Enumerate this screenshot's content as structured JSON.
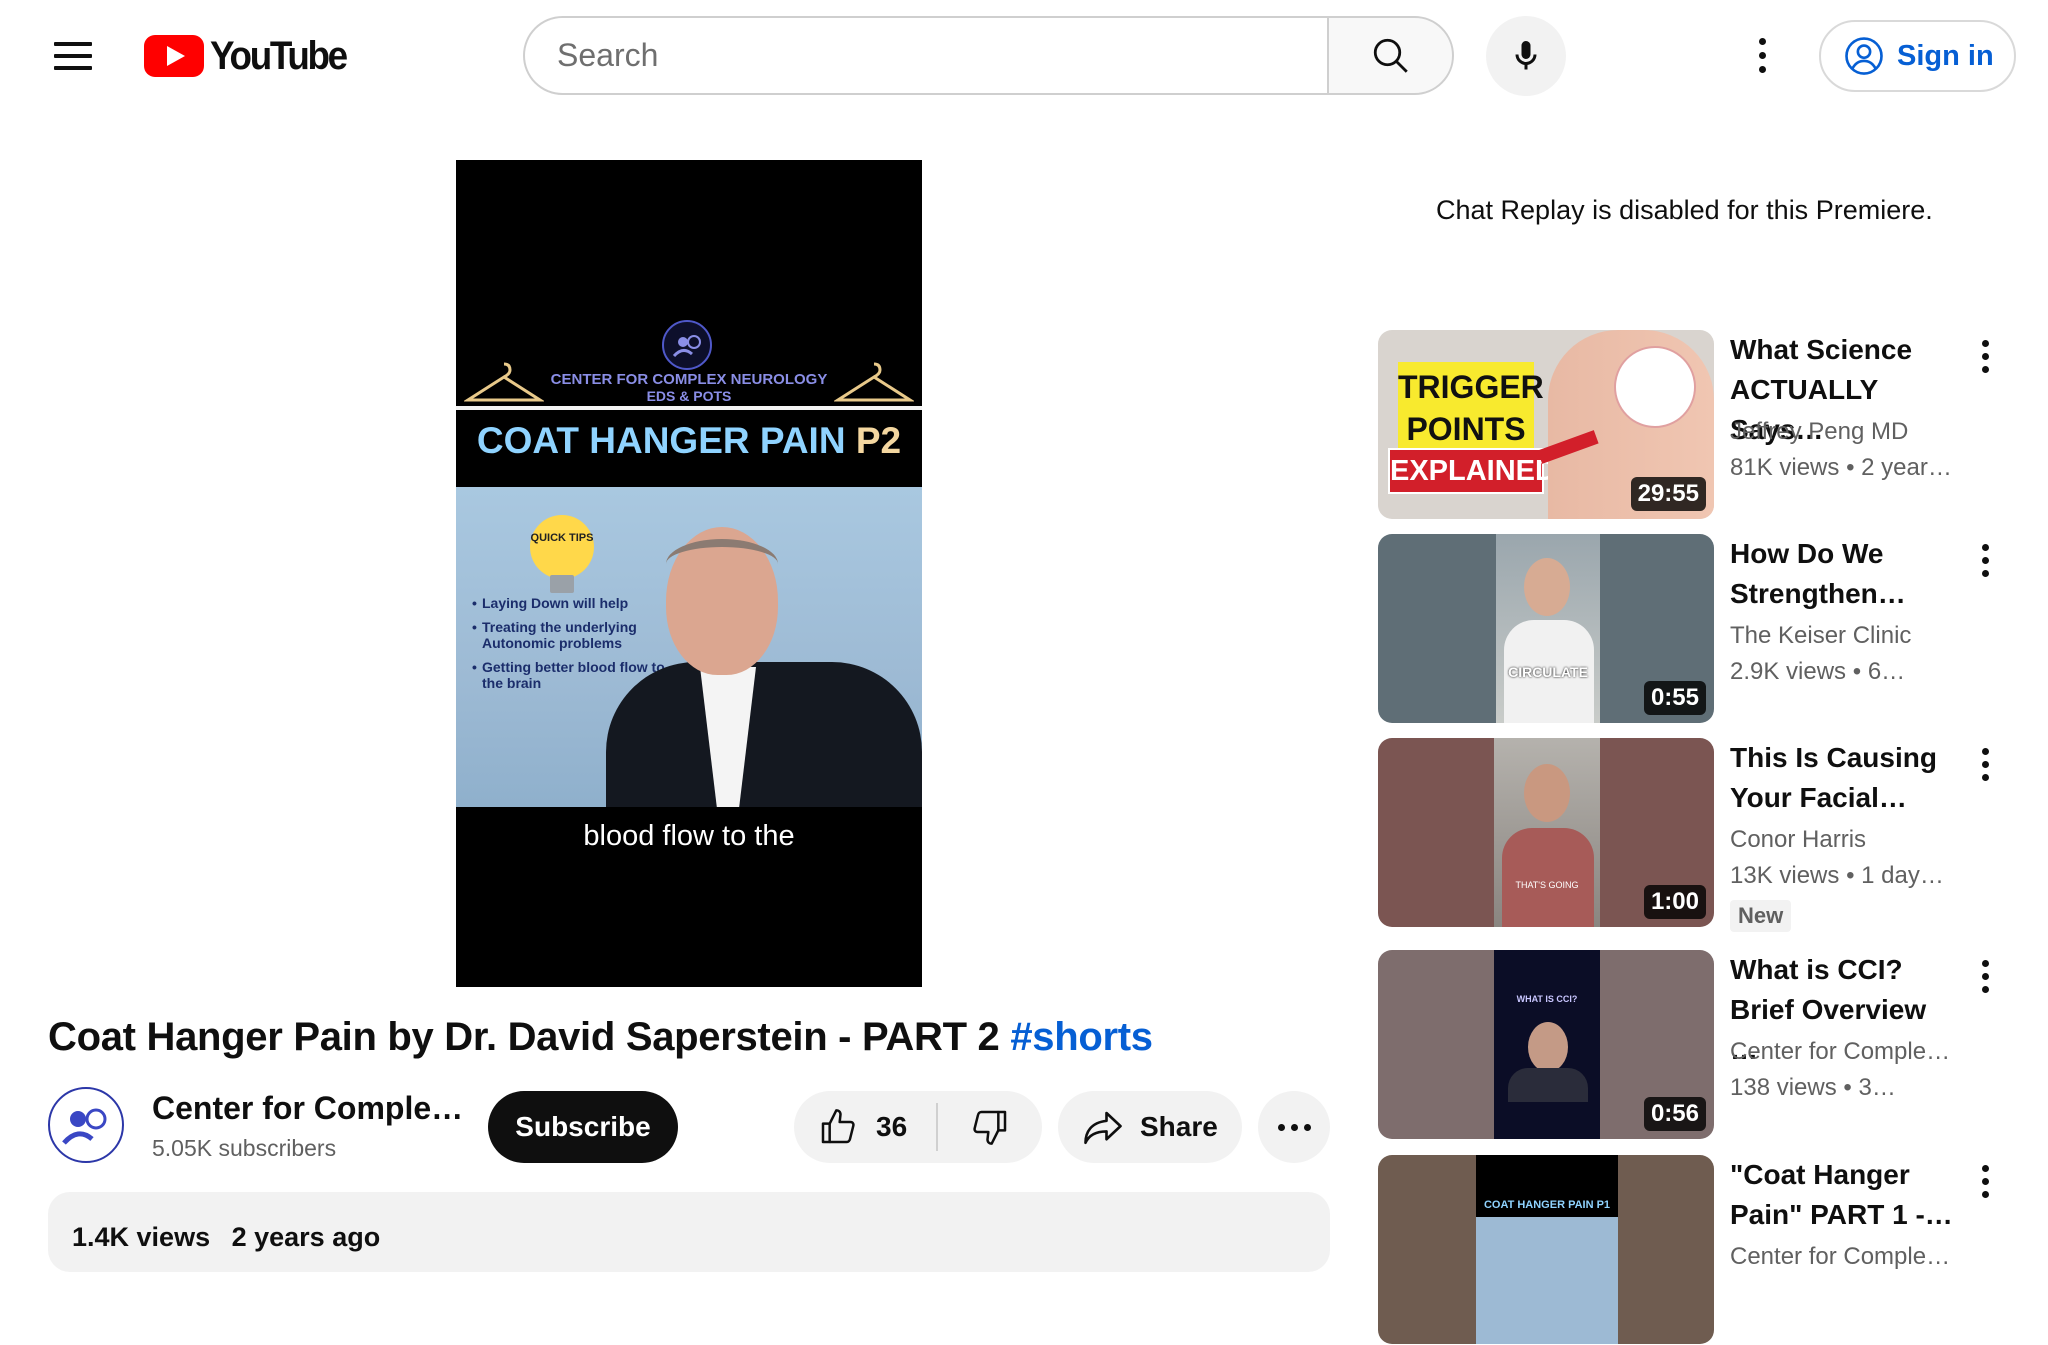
{
  "header": {
    "logo_text": "YouTube",
    "search_placeholder": "Search",
    "sign_in_label": "Sign in"
  },
  "video": {
    "center_name": "CENTER FOR COMPLEX NEUROLOGY",
    "center_sub": "EDS & POTS",
    "banner_main": "COAT HANGER PAIN",
    "banner_part": "P2",
    "bulb_text": "QUICK TIPS",
    "tips": [
      "Laying Down will help",
      "Treating the underlying Autonomic problems",
      "Getting better blood flow to the brain"
    ],
    "caption": "blood flow to the"
  },
  "title": {
    "text": "Coat Hanger Pain by Dr. David Saperstein - PART 2",
    "hashtag": "#shorts"
  },
  "channel": {
    "name": "Center for Comple…",
    "subscribers": "5.05K subscribers",
    "subscribe_label": "Subscribe"
  },
  "actions": {
    "likes": "36",
    "share_label": "Share"
  },
  "description": {
    "views": "1.4K views",
    "date": "2 years ago"
  },
  "chat_replay": "Chat Replay is disabled for this Premiere.",
  "recommendations": [
    {
      "title": "What Science ACTUALLY Says…",
      "channel": "Jeffrey Peng MD",
      "views": "81K views",
      "age": "2 year…",
      "duration": "29:55",
      "thumb_text_1": "TRIGGER",
      "thumb_text_2": "POINTS",
      "thumb_text_3": "EXPLAINED"
    },
    {
      "title": "How Do We Strengthen…",
      "channel": "The Keiser Clinic",
      "views": "2.9K views",
      "age": "6…",
      "duration": "0:55",
      "thumb_caption": "CIRCULATE"
    },
    {
      "title": "This Is Causing Your Facial…",
      "channel": "Conor Harris",
      "views": "13K views",
      "age": "1 day…",
      "duration": "1:00",
      "badge": "New",
      "thumb_caption": "THAT'S GOING"
    },
    {
      "title": "What is CCI? Brief Overview …",
      "channel": "Center for Complex…",
      "views": "138 views",
      "age": "3…",
      "duration": "0:56",
      "thumb_caption": "WHAT IS CCI?"
    },
    {
      "title": "\"Coat Hanger Pain\" PART 1 -…",
      "channel": "Center for Complex…",
      "thumb_caption": "COAT HANGER PAIN P1"
    }
  ],
  "colors": {
    "youtube_red": "#ff0000",
    "link_blue": "#065fd4",
    "secondary_text": "#606060",
    "chip_bg": "#f2f2f2"
  }
}
